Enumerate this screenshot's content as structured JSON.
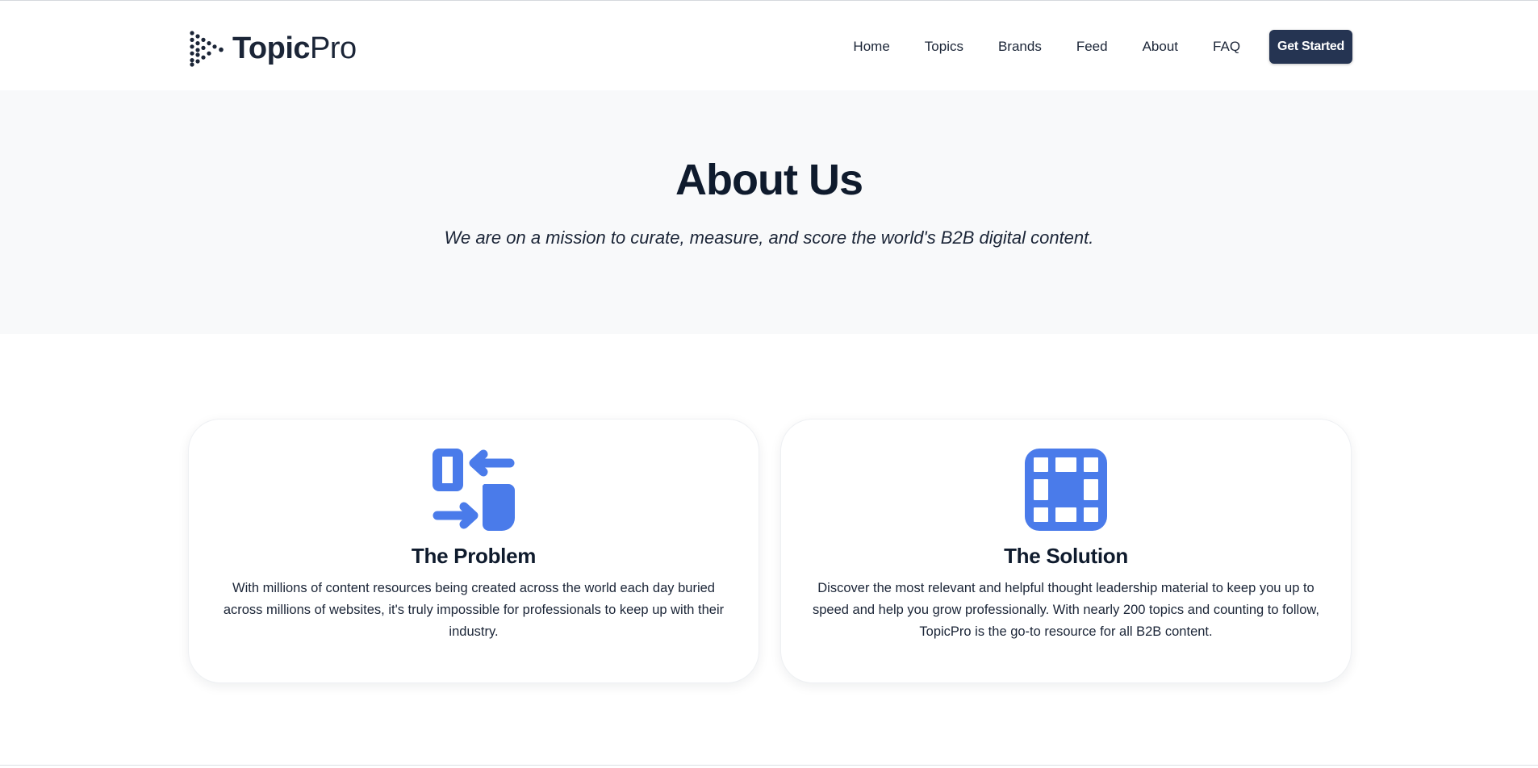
{
  "header": {
    "logo": {
      "icon": "play-dots-icon",
      "brand_strong": "Topic",
      "brand_light": "Pro"
    },
    "nav": [
      {
        "label": "Home"
      },
      {
        "label": "Topics"
      },
      {
        "label": "Brands"
      },
      {
        "label": "Feed"
      },
      {
        "label": "About"
      },
      {
        "label": "FAQ"
      }
    ],
    "cta_label": "Get Started"
  },
  "hero": {
    "title": "About Us",
    "subtitle": "We are on a mission to curate, measure, and score the world's B2B digital content."
  },
  "cards": [
    {
      "icon": "arrows-exchange-icon",
      "title": "The Problem",
      "body": "With millions of content resources being created across the world each day buried across millions of websites, it's truly impossible for professionals to keep up with their industry."
    },
    {
      "icon": "grid-icon",
      "title": "The Solution",
      "body": "Discover the most relevant and helpful thought leadership material to keep you up to speed and help you grow professionally. With nearly 200 topics and counting to follow, TopicPro is the go-to resource for all B2B content."
    }
  ],
  "colors": {
    "brand_dark": "#253452",
    "accent_blue": "#4a7bea",
    "hero_bg": "#f8f9fa",
    "text": "#0f1b2d"
  }
}
